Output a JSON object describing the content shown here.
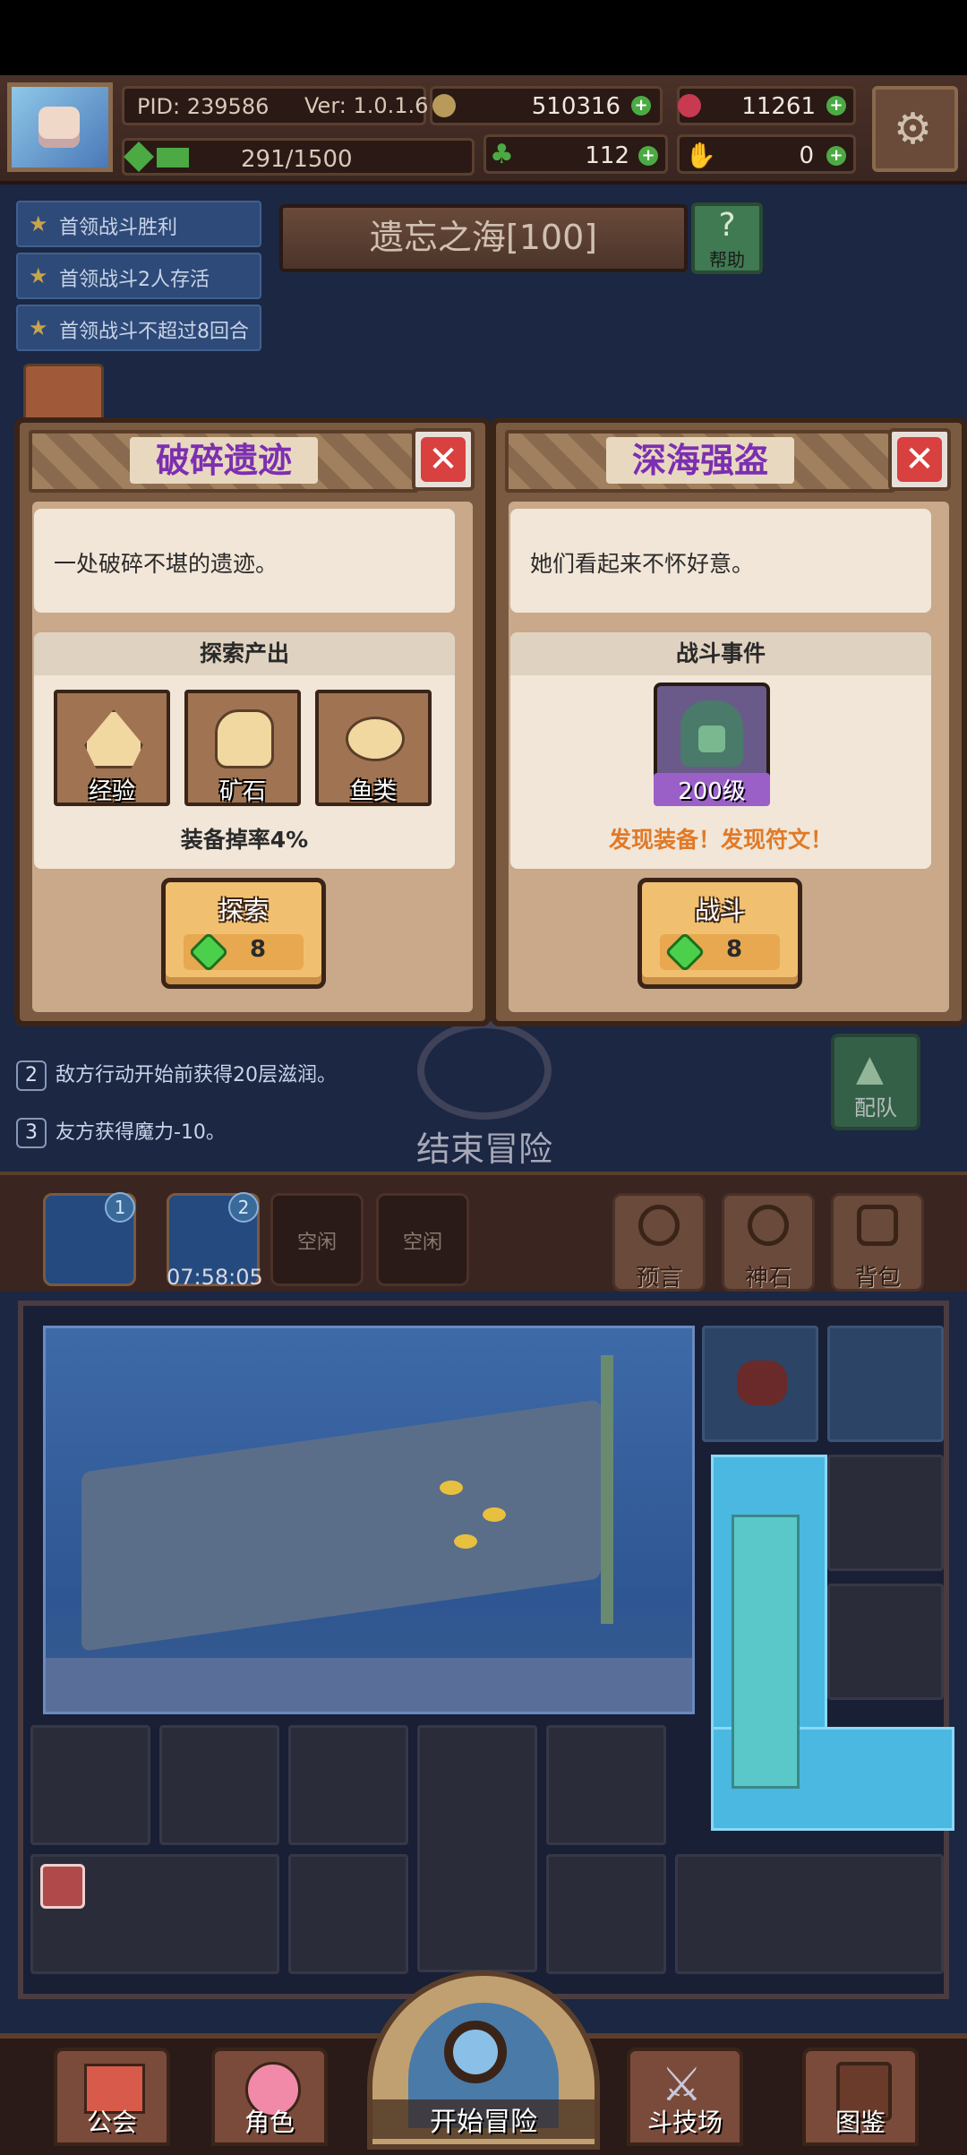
{
  "header": {
    "pid": "PID: 239586",
    "version": "Ver: 1.0.1.6",
    "gold": "510316",
    "gems": "11261",
    "energy": "291/1500",
    "clover": "112",
    "thumbs": "0"
  },
  "quests": [
    "首领战斗胜利",
    "首领战斗2人存活",
    "首领战斗不超过8回合"
  ],
  "stage": {
    "title": "遗忘之海[100]",
    "help_label": "帮助"
  },
  "left_panel": {
    "title": "破碎遗迹",
    "description": "一处破碎不堪的遗迹。",
    "section_title": "探索产出",
    "rewards": [
      {
        "label": "经验",
        "icon": "exp-icon"
      },
      {
        "label": "矿石",
        "icon": "ore-icon"
      },
      {
        "label": "鱼类",
        "icon": "fish-icon"
      }
    ],
    "drop_rate": "装备掉率4%",
    "action_label": "探索",
    "cost": "8"
  },
  "right_panel": {
    "title": "深海强盗",
    "description": "她们看起来不怀好意。",
    "section_title": "战斗事件",
    "enemy_level": "200级",
    "found_text": "发现装备！发现符文！",
    "action_label": "战斗",
    "cost": "8"
  },
  "rules": [
    {
      "n": "2",
      "text": "敌方行动开始前获得20层滋润。"
    },
    {
      "n": "3",
      "text": "友方获得魔力-10。"
    }
  ],
  "end_adventure_label": "结束冒险",
  "team_label": "配队",
  "slots": {
    "badges": [
      "1",
      "2"
    ],
    "idle": [
      "空闲",
      "空闲"
    ],
    "timer": "07:58:05"
  },
  "tools": [
    "预言",
    "神石",
    "背包"
  ],
  "nav": {
    "guild": "公会",
    "character": "角色",
    "start": "开始冒险",
    "arena": "斗技场",
    "codex": "图鉴"
  },
  "colors": {
    "panel_title": "#7c2fb0",
    "found_text": "#e07a28",
    "gem": "#4cd04c"
  }
}
